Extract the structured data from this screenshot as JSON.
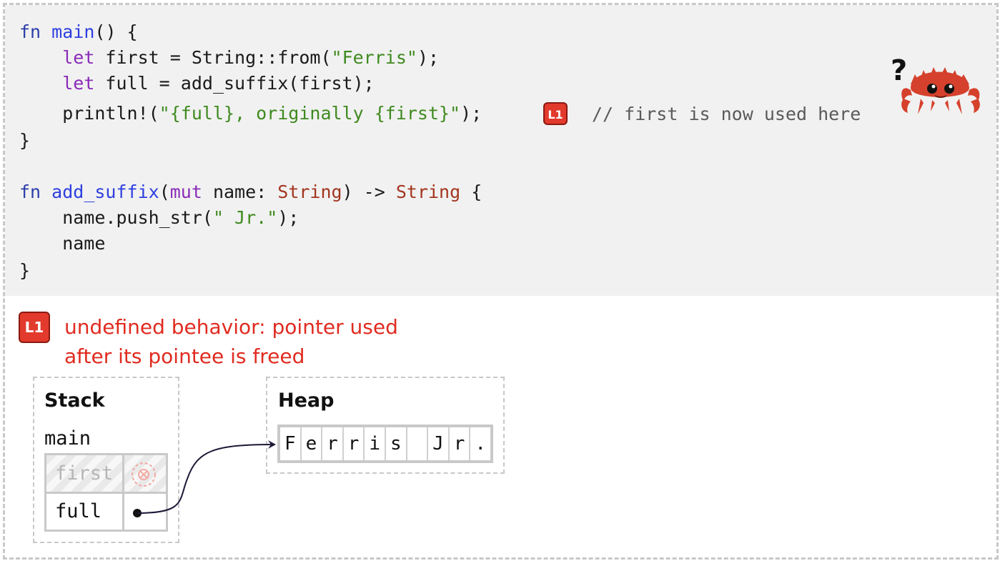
{
  "code": {
    "lines": [
      [
        {
          "t": "fn",
          "c": "fn-kw"
        },
        {
          "t": " "
        },
        {
          "t": "main",
          "c": "fn-name"
        },
        {
          "t": "() {"
        }
      ],
      [
        {
          "t": "    "
        },
        {
          "t": "let",
          "c": "kw"
        },
        {
          "t": " first = String::from("
        },
        {
          "t": "\"Ferris\"",
          "c": "str"
        },
        {
          "t": ");"
        }
      ],
      [
        {
          "t": "    "
        },
        {
          "t": "let",
          "c": "kw"
        },
        {
          "t": " full = add_suffix(first);"
        }
      ],
      [
        {
          "t": "    println!("
        },
        {
          "t": "\"{full}, originally {first}\"",
          "c": "str"
        },
        {
          "t": ");"
        }
      ],
      [
        {
          "t": "}"
        }
      ],
      [
        {
          "t": ""
        }
      ],
      [
        {
          "t": "fn",
          "c": "fn-kw"
        },
        {
          "t": " "
        },
        {
          "t": "add_suffix",
          "c": "fn-name"
        },
        {
          "t": "("
        },
        {
          "t": "mut",
          "c": "kw"
        },
        {
          "t": " name: "
        },
        {
          "t": "String",
          "c": "ty"
        },
        {
          "t": ") -> "
        },
        {
          "t": "String",
          "c": "ty"
        },
        {
          "t": " {"
        }
      ],
      [
        {
          "t": "    name.push_str("
        },
        {
          "t": "\" Jr.\"",
          "c": "str"
        },
        {
          "t": ");"
        }
      ],
      [
        {
          "t": "    name"
        }
      ],
      [
        {
          "t": "}"
        }
      ]
    ],
    "badge": "L1",
    "comment": "// first is now used here"
  },
  "mascot": {
    "question_mark": "?"
  },
  "error": {
    "badge": "L1",
    "line1": "undefined behavior: pointer used",
    "line2": "after its pointee is freed"
  },
  "stack": {
    "title": "Stack",
    "frame": "main",
    "vars": [
      {
        "name": "first",
        "state": "moved"
      },
      {
        "name": "full",
        "state": "pointer"
      }
    ]
  },
  "heap": {
    "title": "Heap",
    "chars": [
      "F",
      "e",
      "r",
      "r",
      "i",
      "s",
      " ",
      "J",
      "r",
      "."
    ]
  },
  "colors": {
    "error": "#e02b20",
    "badge": "#e23a2c",
    "keyword": "#8a2bb8",
    "string": "#3f8a1f",
    "type": "#a3351f"
  }
}
